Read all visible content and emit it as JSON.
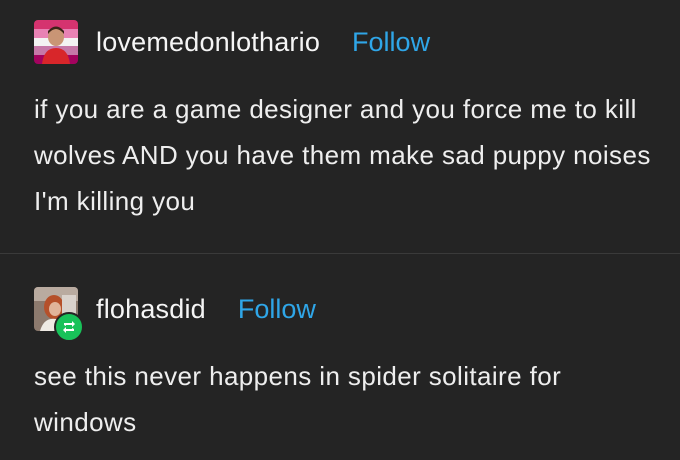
{
  "posts": [
    {
      "username": "lovemedonlothario",
      "follow_label": "Follow",
      "avatar_icon": "user-avatar-icon",
      "text": "if you are a game designer and you force me to kill wolves AND you have them make sad puppy noises I'm killing you"
    },
    {
      "username": "flohasdid",
      "follow_label": "Follow",
      "avatar_icon": "user-avatar-icon",
      "badge_icon": "reblog-icon",
      "text": "see this never happens in spider solitaire for windows"
    }
  ],
  "colors": {
    "background": "#242424",
    "text": "#eeeeee",
    "follow": "#2fa6e8",
    "reblog_badge": "#18c259"
  }
}
